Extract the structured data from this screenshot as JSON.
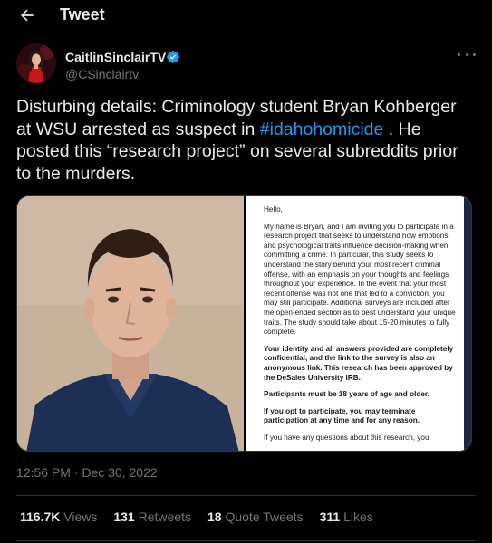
{
  "header": {
    "title": "Tweet"
  },
  "author": {
    "name": "CaitlinSinclairTV",
    "handle": "@CSinclairtv"
  },
  "tweet": {
    "text_before": "Disturbing details: Criminology student Bryan Kohberger at WSU arrested as suspect in ",
    "hashtag": "#idahohomicide",
    "text_after": " . He posted this “research project” on several subreddits prior to the murders."
  },
  "document": {
    "greeting": "Hello,",
    "para1": "My name is Bryan, and I am inviting you to participate in a research project that seeks to understand how emotions and psychological traits influence decision-making when committing a crime. In particular, this study seeks to understand the story behind your most recent criminal offense, with an emphasis on your thoughts and feelings throughout your experience. In the event that your most recent offense was not one that led to a conviction, you may still participate. Additional surveys are included after the open-ended section as to best understand your unique traits. The study should take about 15-20 minutes to fully complete.",
    "para2": "Your identity and all answers provided are completely confidential, and the link to the survey is also an anonymous link. This research has been approved by the DeSales University IRB.",
    "para3": "Participants must be 18 years of age and older.",
    "para4": "If you opt to participate, you may terminate participation at any time and for any reason.",
    "para5": "If you have any questions about this research, you"
  },
  "timestamp": "12:56 PM · Dec 30, 2022",
  "stats": {
    "views_count": "116.7K",
    "views_label": "Views",
    "retweets_count": "131",
    "retweets_label": "Retweets",
    "quotes_count": "18",
    "quotes_label": "Quote Tweets",
    "likes_count": "311",
    "likes_label": "Likes"
  },
  "colors": {
    "background": "#000000",
    "text": "#e7e9ea",
    "muted": "#71767b",
    "accent": "#1d9bf0",
    "divider": "#2f3336"
  },
  "icons": {
    "back": "arrow-left-icon",
    "verified": "verified-badge-icon",
    "more": "more-horizontal-icon"
  }
}
